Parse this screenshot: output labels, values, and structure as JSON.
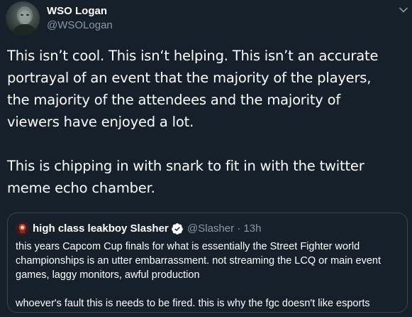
{
  "tweet": {
    "author": {
      "name": "WSO Logan",
      "handle": "@WSOLogan"
    },
    "text_lines": [
      "This isn’t cool. This isn‘t helping. This isn’t an accurate",
      "portrayal of an event that the majority of the  players,",
      "the majority of the attendees and the majority of",
      "viewers have enjoyed a lot.",
      "This is chipping in with snark to fit in with the twitter",
      "meme echo chamber."
    ]
  },
  "quoted_tweet": {
    "author": {
      "name": "high class leakboy Slasher",
      "handle_and_time": "@Slasher · 13h"
    },
    "text_lines": [
      "this years Capcom Cup finals for what is essentially the Street Fighter world",
      "championships is an utter embarrassment. not streaming the LCQ or main event",
      "games, laggy monitors, awful production",
      "whoever's fault this is needs to be fired. this is why the fgc doesn't like esports"
    ]
  },
  "colors": {
    "background": "#15202b",
    "secondary_text": "#8899a6",
    "border": "#38444d",
    "verified": "#ffffff"
  },
  "icons": {
    "caret": "chevron-down-icon",
    "verified": "verified-badge-icon"
  }
}
